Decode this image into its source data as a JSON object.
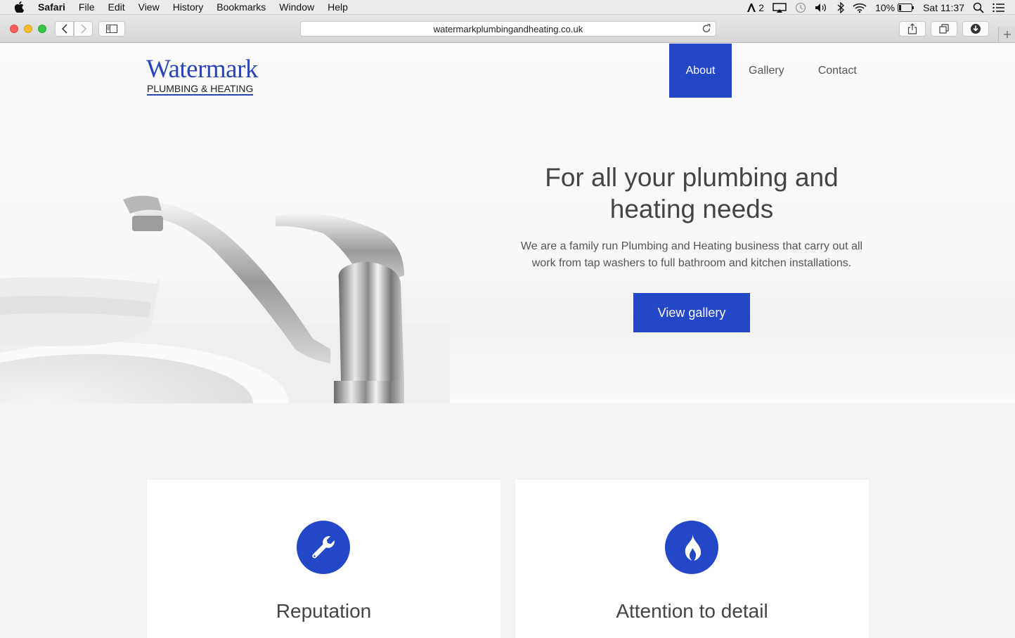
{
  "menubar": {
    "app": "Safari",
    "items": [
      "File",
      "Edit",
      "View",
      "History",
      "Bookmarks",
      "Window",
      "Help"
    ],
    "adobe_count": "2",
    "battery": "10%",
    "clock": "Sat 11:37"
  },
  "browser": {
    "url": "watermarkplumbingandheating.co.uk"
  },
  "site": {
    "logo": {
      "name": "Watermark",
      "tagline": "PLUMBING & HEATING"
    },
    "nav": [
      "About",
      "Gallery",
      "Contact"
    ],
    "nav_active": "About",
    "hero": {
      "title": "For all your plumbing and heating needs",
      "text": "We are a family run Plumbing and Heating business that carry out all work from tap washers to full bathroom and kitchen installations.",
      "cta": "View gallery"
    },
    "features": [
      {
        "title": "Reputation",
        "icon": "wrench-icon"
      },
      {
        "title": "Attention to detail",
        "icon": "flame-icon"
      }
    ]
  },
  "colors": {
    "accent": "#2347c7",
    "logo_blue": "#2a45b8"
  }
}
